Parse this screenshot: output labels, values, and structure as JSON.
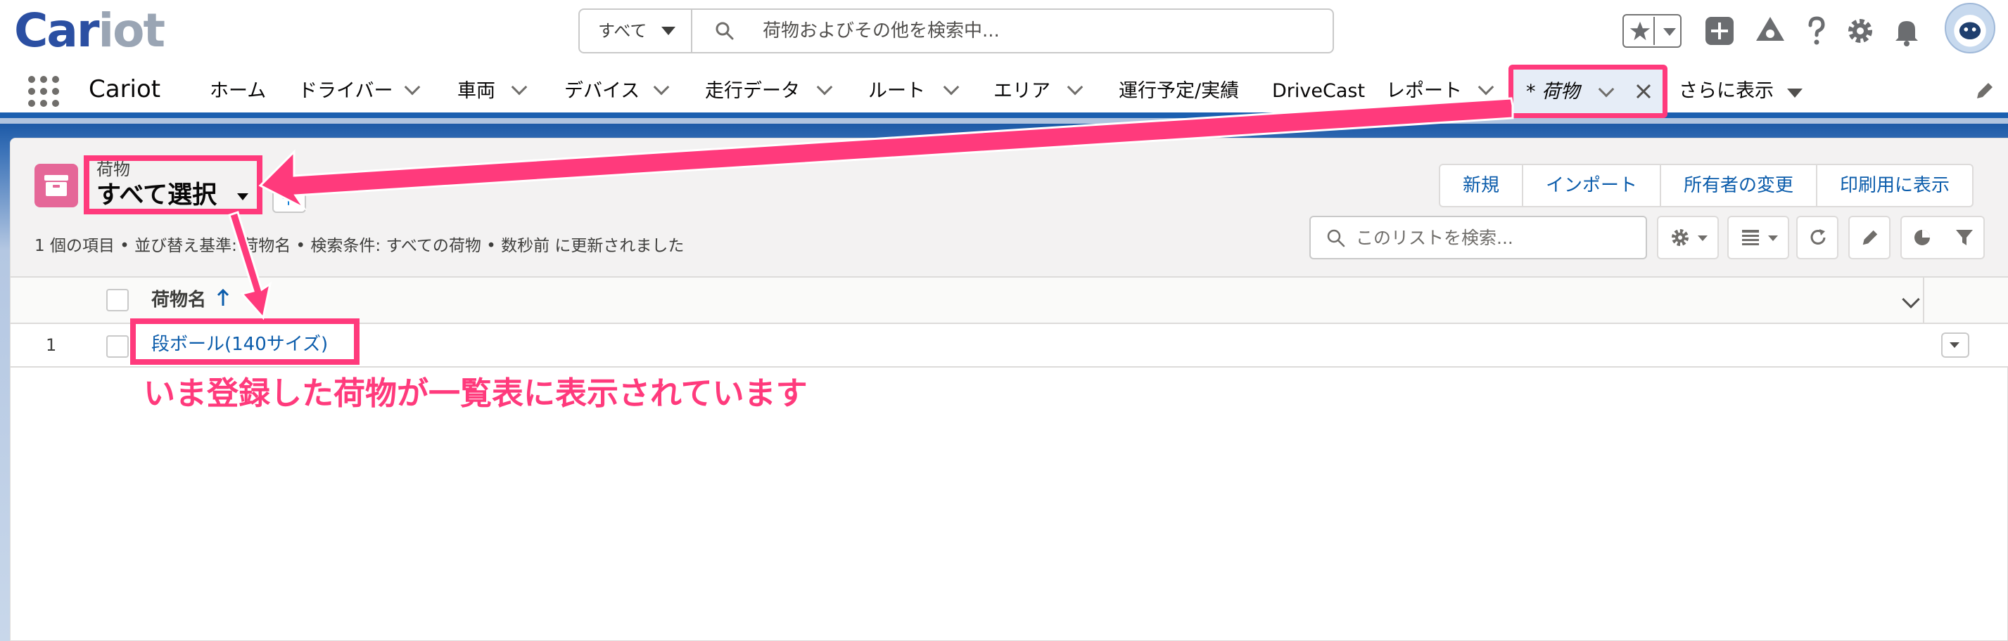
{
  "header": {
    "logo_main": "Car",
    "logo_o": "i",
    "logo_rest": "ot",
    "search_scope": "すべて",
    "search_placeholder": "荷物およびその他を検索中..."
  },
  "nav": {
    "app_name": "Cariot",
    "items": [
      {
        "label": "ホーム"
      },
      {
        "label": "ドライバー"
      },
      {
        "label": "車両"
      },
      {
        "label": "デバイス"
      },
      {
        "label": "走行データ"
      },
      {
        "label": "ルート"
      },
      {
        "label": "エリア"
      },
      {
        "label": "運行予定/実績"
      },
      {
        "label": "DriveCast"
      },
      {
        "label": "レポート"
      }
    ],
    "active_tab": "* 荷物",
    "more": "さらに表示"
  },
  "list_view": {
    "object_label": "荷物",
    "view_name": "すべて選択",
    "buttons": [
      {
        "label": "新規"
      },
      {
        "label": "インポート"
      },
      {
        "label": "所有者の変更"
      },
      {
        "label": "印刷用に表示"
      }
    ],
    "summary": "1 個の項目 • 並び替え基準: 荷物名 • 検索条件: すべての荷物 • 数秒前 に更新されました",
    "search_placeholder": "このリストを検索...",
    "column_header": "荷物名",
    "rows": [
      {
        "num": "1",
        "name": "段ボール(140サイズ)"
      }
    ]
  },
  "annotation": "いま登録した荷物が一覧表に表示されています",
  "colors": {
    "highlight": "#ff3a7c",
    "brand_blue": "#2b4fa2",
    "link": "#0b5cab",
    "object_icon": "#e56798"
  }
}
